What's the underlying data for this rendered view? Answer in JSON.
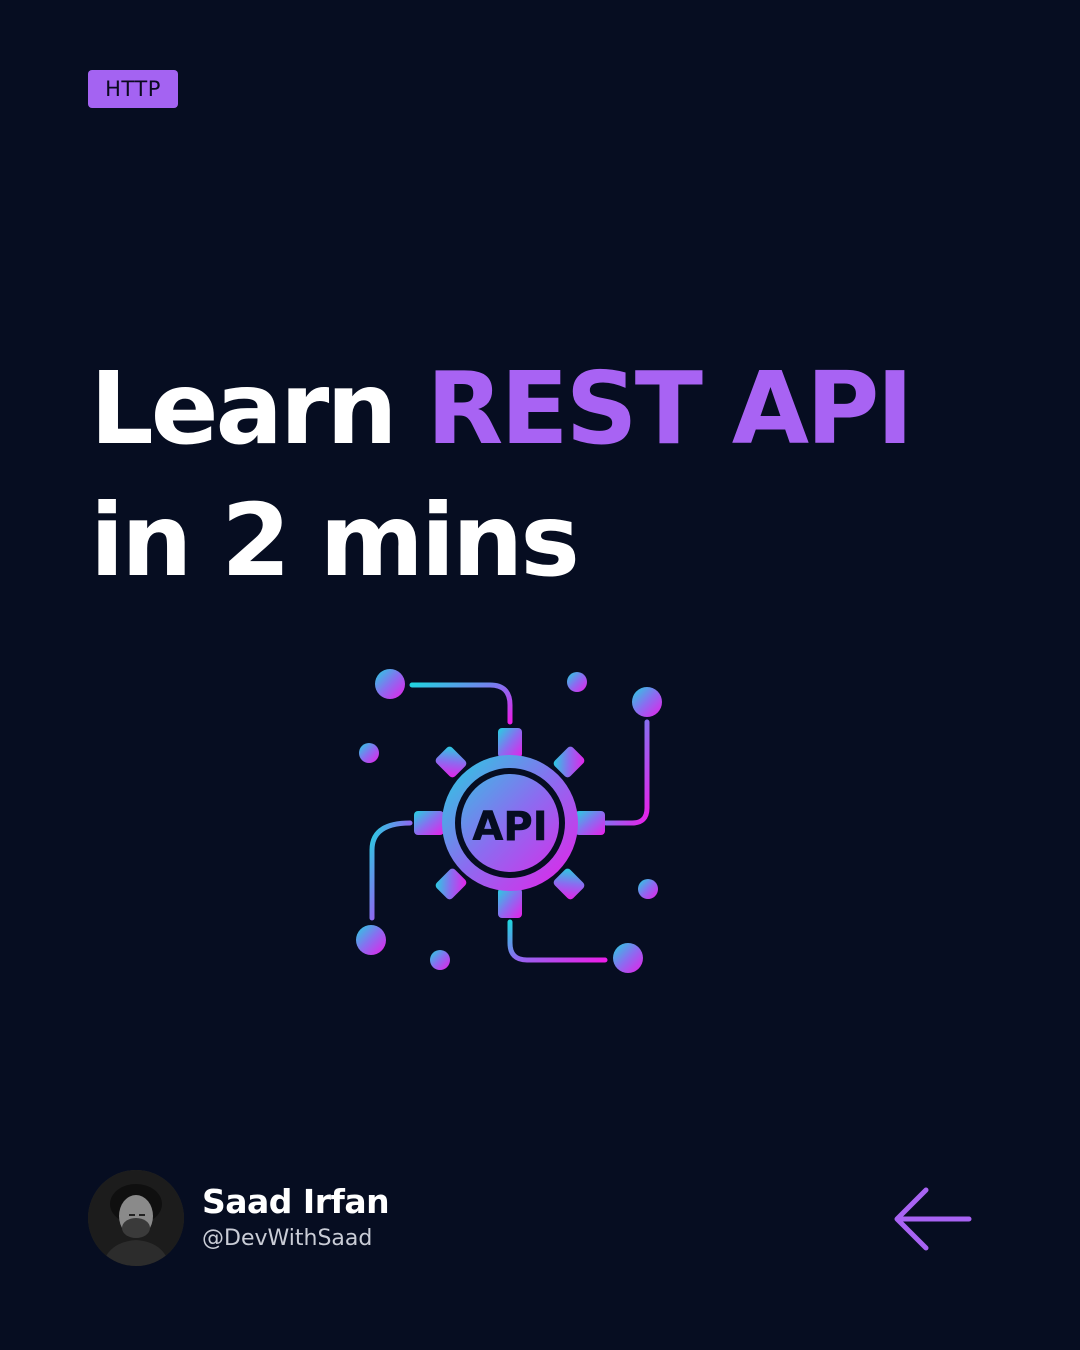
{
  "tag": {
    "label": "HTTP"
  },
  "headline": {
    "lead": "Learn ",
    "accent": "REST API",
    "line2": "in 2 mins"
  },
  "illustration": {
    "gear_label": "API",
    "icon": "api-gear-network-icon",
    "gradient_colors": [
      "#22d3e0",
      "#8b6cf0",
      "#ea1ee8"
    ]
  },
  "author": {
    "name": "Saad Irfan",
    "handle": "@DevWithSaad"
  },
  "colors": {
    "background": "#060d21",
    "accent": "#a863f3",
    "text": "#ffffff"
  },
  "nav": {
    "icon": "arrow-left-icon"
  }
}
